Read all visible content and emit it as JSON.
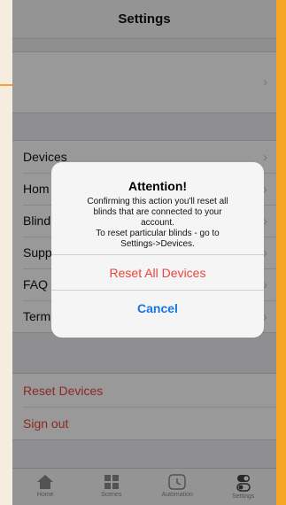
{
  "navbar": {
    "title": "Settings"
  },
  "list_items": [
    {
      "label": "Devices"
    },
    {
      "label": "Hom"
    },
    {
      "label": "Blind"
    },
    {
      "label": "Supp"
    },
    {
      "label": "FAQ"
    },
    {
      "label": "Term"
    }
  ],
  "red_items": [
    {
      "label": "Reset Devices"
    },
    {
      "label": "Sign out"
    }
  ],
  "tabs": [
    {
      "label": "Home",
      "icon": "home-icon"
    },
    {
      "label": "Scenes",
      "icon": "grid-icon"
    },
    {
      "label": "Automation",
      "icon": "clock-icon"
    },
    {
      "label": "Settings",
      "icon": "toggle-icon"
    }
  ],
  "alert": {
    "title": "Attention!",
    "message": "Confirming this action you'll reset all\nblinds that are connected to your\naccount.\nTo reset particular blinds - go to\nSettings->Devices.",
    "confirm_label": "Reset All Devices",
    "cancel_label": "Cancel"
  },
  "colors": {
    "destructive": "#e8453c",
    "action": "#1a73e8",
    "frame_accent": "#f5a623"
  }
}
